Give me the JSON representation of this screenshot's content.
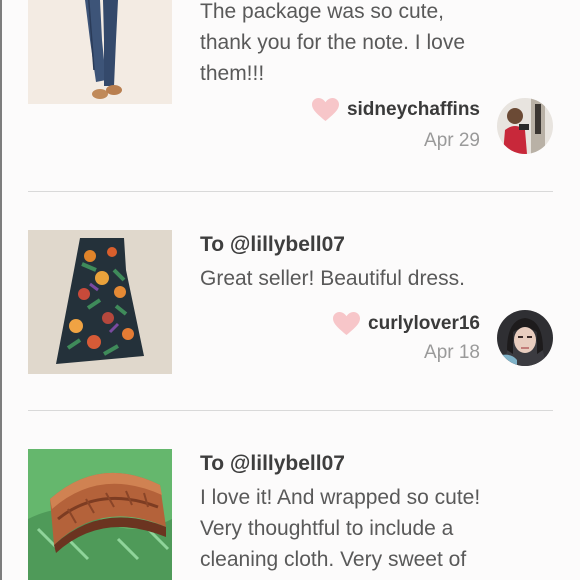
{
  "reviews": [
    {
      "note_lines": [
        "The package was so cute,",
        "thank you for the note. I love",
        "them!!!"
      ],
      "username": "sidneychaffins",
      "date": "Apr 29"
    },
    {
      "to": "To @lillybell07",
      "note_lines": [
        "Great seller! Beautiful dress."
      ],
      "username": "curlylover16",
      "date": "Apr 18"
    },
    {
      "to": "To @lillybell07",
      "note_lines": [
        "I love it! And wrapped so cute!",
        "Very thoughtful to include a",
        "cleaning cloth. Very sweet of"
      ]
    }
  ],
  "icons": {
    "like": "heart-icon"
  },
  "colors": {
    "heart": "#f7c6c9",
    "text_dark": "#3e3e3e",
    "text_body": "#595959",
    "text_muted": "#9a9a9a"
  }
}
